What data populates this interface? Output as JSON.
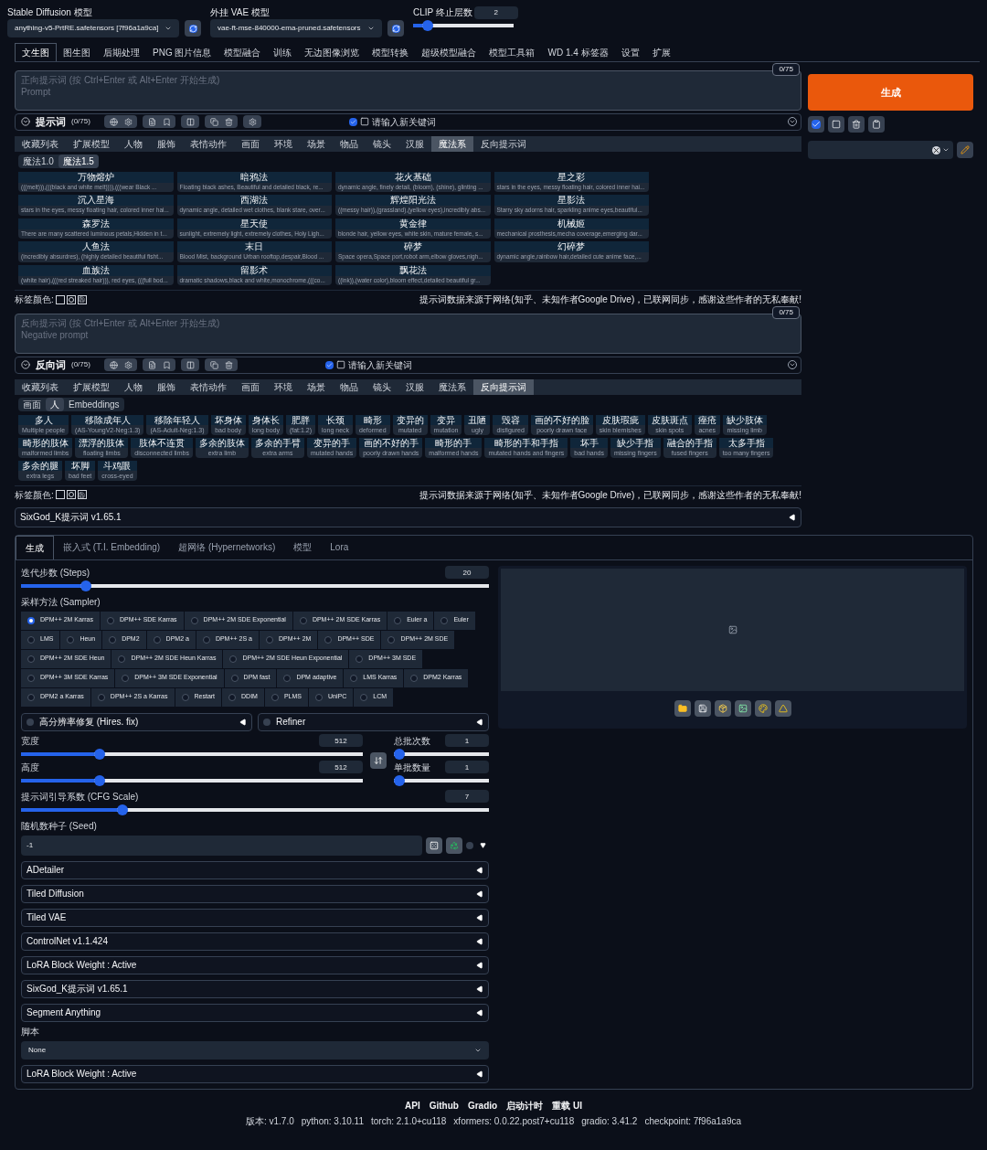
{
  "models": [
    {
      "label": "Stable Diffusion 模型",
      "value": "anything-v5-PrtRE.safetensors [7f96a1a9ca]"
    },
    {
      "label": "外挂 VAE 模型",
      "value": "vae-ft-mse-840000-ema-pruned.safetensors"
    }
  ],
  "clip": {
    "label": "CLIP 终止层数",
    "value": "2",
    "level": 0.1
  },
  "main_tabs": [
    {
      "label": "文生图",
      "selected": true
    },
    {
      "label": "图生图",
      "selected": false
    },
    {
      "label": "后期处理",
      "selected": false
    },
    {
      "label": "PNG 图片信息",
      "selected": false
    },
    {
      "label": "模型融合",
      "selected": false
    },
    {
      "label": "训练",
      "selected": false
    },
    {
      "label": "无边图像浏览",
      "selected": false
    },
    {
      "label": "模型转换",
      "selected": false
    },
    {
      "label": "超级模型融合",
      "selected": false
    },
    {
      "label": "模型工具箱",
      "selected": false
    },
    {
      "label": "WD 1.4 标签器",
      "selected": false
    },
    {
      "label": "设置",
      "selected": false
    },
    {
      "label": "扩展",
      "selected": false
    }
  ],
  "prompt": {
    "count": "0/75",
    "placeholder": [
      "正向提示词 (按 Ctrl+Enter 或 Alt+Enter 开始生成)",
      "Prompt"
    ],
    "title": "提示词",
    "token_count": "(0/75)",
    "keyword_checked": true,
    "keyword_placeholder": "请输入新关键词",
    "categories": [
      {
        "label": "收藏列表",
        "selected": false
      },
      {
        "label": "扩展模型",
        "selected": false
      },
      {
        "label": "人物",
        "selected": false
      },
      {
        "label": "服饰",
        "selected": false
      },
      {
        "label": "表情动作",
        "selected": false
      },
      {
        "label": "画面",
        "selected": false
      },
      {
        "label": "环境",
        "selected": false
      },
      {
        "label": "场景",
        "selected": false
      },
      {
        "label": "物品",
        "selected": false
      },
      {
        "label": "镜头",
        "selected": false
      },
      {
        "label": "汉服",
        "selected": false
      },
      {
        "label": "魔法系",
        "selected": true
      },
      {
        "label": "反向提示词",
        "selected": false
      }
    ],
    "subtabs": [
      {
        "label": "魔法1.0",
        "selected": false
      },
      {
        "label": "魔法1.5",
        "selected": true
      }
    ],
    "cards": [
      {
        "title": "万物熔炉",
        "text": "(((melt))),(((black and white melt)))),(((wear Black ..."
      },
      {
        "title": "暗鸦法",
        "text": "Floating black ashes, Beautiful and detailed black, re..."
      },
      {
        "title": "花火基础",
        "text": "dynamic angle, finely detail, (bloom), (shine), glinting ..."
      },
      {
        "title": "星之彩",
        "text": "stars in the eyes, messy floating hair, colored inner hai..."
      },
      {
        "title": "沉入星海",
        "text": "stars in the eyes, messy floating hair, colored inner hai..."
      },
      {
        "title": "西湖法",
        "text": "dynamic angle, detailed wet clothes, blank stare, over..."
      },
      {
        "title": "辉煌阳光法",
        "text": "((messy hair)),(grassland),(yellow eyes),incredibly abs..."
      },
      {
        "title": "星影法",
        "text": "Starry sky adorns hair, sparkling anime eyes,beautiful..."
      },
      {
        "title": "森罗法",
        "text": "There are many scattered luminous petals,Hidden in t..."
      },
      {
        "title": "星天使",
        "text": "sunlight, extremely light, extremely clothes, Holy Ligh..."
      },
      {
        "title": "黄金律",
        "text": "blonde hair, yellow eyes, white skin, mature female, s..."
      },
      {
        "title": "机械姬",
        "text": "mechanical prosthesis,mecha coverage,emerging dar..."
      },
      {
        "title": "人鱼法",
        "text": "(incredibly absurdres), (highly detailed beautiful fisht..."
      },
      {
        "title": "末日",
        "text": "Blood Mist, background Urban rooftop,despair,Blood ..."
      },
      {
        "title": "碎梦",
        "text": "Space opera,Space port,robot arm,elbow gloves,nigh..."
      },
      {
        "title": "幻碎梦",
        "text": "dynamic angle,rainbow hair,detailed cute anime face,..."
      },
      {
        "title": "血族法",
        "text": "(white hair),(((red streaked hair))), red eyes, (((full bod..."
      },
      {
        "title": "留影术",
        "text": "dramatic shadows,black and white,monochrome,(((co..."
      },
      {
        "title": "飘花法",
        "text": "((ink)),(water color),bloom effect,detailed beautiful gr..."
      }
    ],
    "tag_color_label": "标签颜色:",
    "notice": "提示词数据来源于网络(知乎、未知作者Google Drive)，已联网同步，感谢这些作者的无私奉献!"
  },
  "negative": {
    "count": "0/75",
    "placeholder": [
      "反向提示词 (按 Ctrl+Enter 或 Alt+Enter 开始生成)",
      "Negative prompt"
    ],
    "title": "反向词",
    "token_count": "(0/75)",
    "keyword_checked": true,
    "keyword_placeholder": "请输入新关键词",
    "categories": [
      {
        "label": "收藏列表",
        "selected": false
      },
      {
        "label": "扩展模型",
        "selected": false
      },
      {
        "label": "人物",
        "selected": false
      },
      {
        "label": "服饰",
        "selected": false
      },
      {
        "label": "表情动作",
        "selected": false
      },
      {
        "label": "画面",
        "selected": false
      },
      {
        "label": "环境",
        "selected": false
      },
      {
        "label": "场景",
        "selected": false
      },
      {
        "label": "物品",
        "selected": false
      },
      {
        "label": "镜头",
        "selected": false
      },
      {
        "label": "汉服",
        "selected": false
      },
      {
        "label": "魔法系",
        "selected": false
      },
      {
        "label": "反向提示词",
        "selected": true
      }
    ],
    "subtabs": [
      {
        "label": "画面",
        "selected": false
      },
      {
        "label": "人",
        "selected": true
      },
      {
        "label": "Embeddings",
        "selected": false
      }
    ],
    "chips": [
      {
        "title": "多人",
        "text": "Multiple people"
      },
      {
        "title": "移除成年人",
        "text": "(AS-YoungV2-Neg:1.3)"
      },
      {
        "title": "移除年轻人",
        "text": "(AS-Adult-Neg:1.3)"
      },
      {
        "title": "坏身体",
        "text": "bad body"
      },
      {
        "title": "身体长",
        "text": "long body"
      },
      {
        "title": "肥胖",
        "text": "(fat:1.2)"
      },
      {
        "title": "长颈",
        "text": "long neck"
      },
      {
        "title": "畸形",
        "text": "deformed"
      },
      {
        "title": "变异的",
        "text": "mutated"
      },
      {
        "title": "变异",
        "text": "mutation"
      },
      {
        "title": "丑陋",
        "text": "ugly"
      },
      {
        "title": "毁容",
        "text": "disfigured"
      },
      {
        "title": "画的不好的脸",
        "text": "poorly drawn face"
      },
      {
        "title": "皮肤瑕疵",
        "text": "skin blemishes"
      },
      {
        "title": "皮肤斑点",
        "text": "skin spots"
      },
      {
        "title": "痤疮",
        "text": "acnes"
      },
      {
        "title": "缺少肢体",
        "text": "missing limb"
      },
      {
        "title": "畸形的肢体",
        "text": "malformed limbs"
      },
      {
        "title": "漂浮的肢体",
        "text": "floating limbs"
      },
      {
        "title": "肢体不连贯",
        "text": "disconnected limbs"
      },
      {
        "title": "多余的肢体",
        "text": "extra limb"
      },
      {
        "title": "多余的手臂",
        "text": "extra arms"
      },
      {
        "title": "变异的手",
        "text": "mutated hands"
      },
      {
        "title": "画的不好的手",
        "text": "poorly drawn hands"
      },
      {
        "title": "畸形的手",
        "text": "malformed hands"
      },
      {
        "title": "畸形的手和手指",
        "text": "mutated hands and fingers"
      },
      {
        "title": "坏手",
        "text": "bad hands"
      },
      {
        "title": "缺少手指",
        "text": "missing fingers"
      },
      {
        "title": "融合的手指",
        "text": "fused fingers"
      },
      {
        "title": "太多手指",
        "text": "too many fingers"
      },
      {
        "title": "多余的腿",
        "text": "extra legs"
      },
      {
        "title": "坏脚",
        "text": "bad feet"
      },
      {
        "title": "斗鸡眼",
        "text": "cross-eyed"
      }
    ],
    "tag_color_label": "标签颜色:",
    "notice": "提示词数据来源于网络(知乎、未知作者Google Drive)，已联网同步，感谢这些作者的无私奉献!"
  },
  "generate": "生成",
  "sixgod": "SixGod_K提示词 v1.65.1",
  "gen_tabs": [
    {
      "label": "生成",
      "selected": true
    },
    {
      "label": "嵌入式 (T.I. Embedding)",
      "selected": false
    },
    {
      "label": "超网络 (Hypernetworks)",
      "selected": false
    },
    {
      "label": "模型",
      "selected": false
    },
    {
      "label": "Lora",
      "selected": false
    }
  ],
  "steps": {
    "label": "迭代步数 (Steps)",
    "value": "20",
    "level": 0.13
  },
  "sampler": {
    "label": "采样方法 (Sampler)",
    "options": [
      {
        "label": "DPM++ 2M Karras",
        "selected": true
      },
      {
        "label": "DPM++ SDE Karras",
        "selected": false
      },
      {
        "label": "DPM++ 2M SDE Exponential",
        "selected": false
      },
      {
        "label": "DPM++ 2M SDE Karras",
        "selected": false
      },
      {
        "label": "Euler a",
        "selected": false
      },
      {
        "label": "Euler",
        "selected": false
      },
      {
        "label": "LMS",
        "selected": false
      },
      {
        "label": "Heun",
        "selected": false
      },
      {
        "label": "DPM2",
        "selected": false
      },
      {
        "label": "DPM2 a",
        "selected": false
      },
      {
        "label": "DPM++ 2S a",
        "selected": false
      },
      {
        "label": "DPM++ 2M",
        "selected": false
      },
      {
        "label": "DPM++ SDE",
        "selected": false
      },
      {
        "label": "DPM++ 2M SDE",
        "selected": false
      },
      {
        "label": "DPM++ 2M SDE Heun",
        "selected": false
      },
      {
        "label": "DPM++ 2M SDE Heun Karras",
        "selected": false
      },
      {
        "label": "DPM++ 2M SDE Heun Exponential",
        "selected": false
      },
      {
        "label": "DPM++ 3M SDE",
        "selected": false
      },
      {
        "label": "DPM++ 3M SDE Karras",
        "selected": false
      },
      {
        "label": "DPM++ 3M SDE Exponential",
        "selected": false
      },
      {
        "label": "DPM fast",
        "selected": false
      },
      {
        "label": "DPM adaptive",
        "selected": false
      },
      {
        "label": "LMS Karras",
        "selected": false
      },
      {
        "label": "DPM2 Karras",
        "selected": false
      },
      {
        "label": "DPM2 a Karras",
        "selected": false
      },
      {
        "label": "DPM++ 2S a Karras",
        "selected": false
      },
      {
        "label": "Restart",
        "selected": false
      },
      {
        "label": "DDIM",
        "selected": false
      },
      {
        "label": "PLMS",
        "selected": false
      },
      {
        "label": "UniPC",
        "selected": false
      },
      {
        "label": "LCM",
        "selected": false
      }
    ]
  },
  "hires": {
    "label": "高分辨率修复 (Hires. fix)",
    "checked": false
  },
  "refiner": {
    "label": "Refiner",
    "checked": false
  },
  "width": {
    "label": "宽度",
    "value": "512",
    "level": 0.22
  },
  "height": {
    "label": "高度",
    "value": "512",
    "level": 0.22
  },
  "batch_count": {
    "label": "总批次数",
    "value": "1",
    "level": 0
  },
  "batch_size": {
    "label": "单批数量",
    "value": "1",
    "level": 0
  },
  "cfg": {
    "label": "提示词引导系数 (CFG Scale)",
    "value": "7",
    "level": 0.21
  },
  "seed": {
    "label": "随机数种子 (Seed)",
    "value": "-1",
    "extra_checked": false
  },
  "accordions": [
    "ADetailer",
    "Tiled Diffusion",
    "Tiled VAE",
    "ControlNet v1.1.424",
    "LoRA Block Weight : Active",
    "SixGod_K提示词 v1.65.1",
    "Segment Anything"
  ],
  "script": {
    "label": "脚本",
    "value": "None"
  },
  "accordions_after": [
    "LoRA Block Weight : Active"
  ],
  "footer": {
    "links": [
      "API",
      "Github",
      "Gradio",
      "启动计时",
      "重载 UI"
    ],
    "versions": [
      "版本: v1.7.0",
      "python: 3.10.11",
      "torch: 2.1.0+cu118",
      "xformers: 0.0.22.post7+cu118",
      "gradio: 3.41.2",
      "checkpoint: 7f96a1a9ca"
    ]
  }
}
